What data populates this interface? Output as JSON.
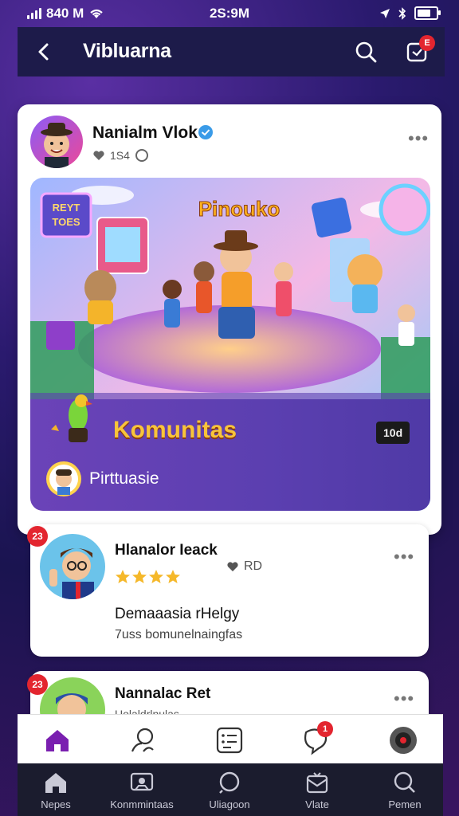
{
  "status": {
    "carrier": "840 M",
    "time": "2S:9M"
  },
  "appbar": {
    "title": "Vibluarna",
    "notif_badge": "E"
  },
  "post": {
    "author": "Nanialm Vlok",
    "meta": "1S4",
    "banner_sign_top": "REYT",
    "banner_sign_bottom": "TOES",
    "banner_heading": "Pinouko",
    "banner_title": "Komunitas",
    "banner_count": "10d",
    "banner_subtitle": "Pirttuasie"
  },
  "items": [
    {
      "badge": "23",
      "title": "Hlanalor Ieack",
      "meta": "RD",
      "heading": "Demaaasia rHelgy",
      "desc": "7uss bomunelnaingfas",
      "stars": 4
    },
    {
      "badge": "23",
      "title": "Nannalac Ret",
      "meta": "Uolaldrlnulas",
      "heading": "",
      "desc": ""
    }
  ],
  "bottom_nav": [
    {
      "label": "Nepes",
      "icon": "home-icon"
    },
    {
      "label": "Konmmintaas",
      "icon": "community-icon"
    },
    {
      "label": "Uliagoon",
      "icon": "search-icon"
    },
    {
      "label": "Vlate",
      "icon": "inbox-icon"
    },
    {
      "label": "Pemen",
      "icon": "search-icon"
    }
  ],
  "tab_badge": "1",
  "colors": {
    "accent": "#7a2ca8",
    "badge": "#e3252f",
    "banner": "#5b3fb0",
    "title_gold": "#f8c43a"
  }
}
